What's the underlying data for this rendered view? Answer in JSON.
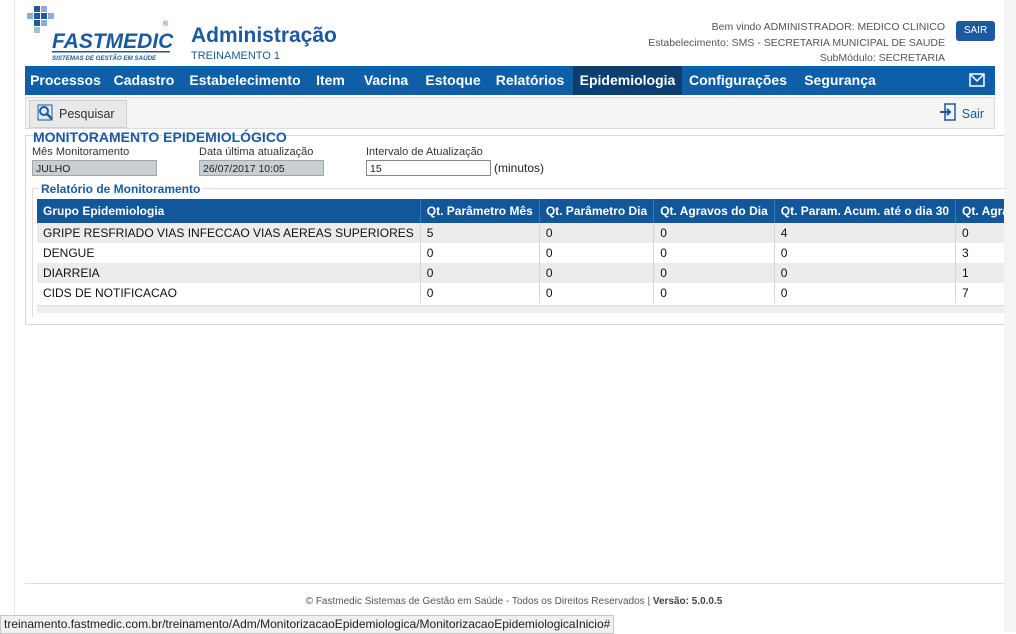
{
  "header": {
    "logo_text": "FASTMEDIC",
    "logo_tagline": "SISTEMAS DE GESTÃO EM SAÚDE",
    "title": "Administração",
    "subtitle": "TREINAMENTO 1",
    "welcome": "Bem vindo ADMINISTRADOR: MEDICO CLINICO",
    "establishment": "Estabelecimento: SMS - SECRETARIA MUNICIPAL DE SAUDE",
    "submodule": "SubMódulo: SECRETARIA",
    "logout_label": "SAIR"
  },
  "menu": {
    "items": [
      {
        "label": "Processos"
      },
      {
        "label": "Cadastro"
      },
      {
        "label": "Estabelecimento"
      },
      {
        "label": "Item"
      },
      {
        "label": "Vacina"
      },
      {
        "label": "Estoque"
      },
      {
        "label": "Relatórios"
      },
      {
        "label": "Epidemiologia"
      },
      {
        "label": "Configurações"
      },
      {
        "label": "Segurança"
      }
    ],
    "active": "Epidemiologia",
    "mail_icon": "envelope-icon"
  },
  "toolbar": {
    "search_label": "Pesquisar",
    "exit_label": "Sair"
  },
  "section": {
    "title": "MONITORAMENTO EPIDEMIOLÓGICO",
    "month_label": "Mês Monitoramento",
    "month_value": "JULHO",
    "last_update_label": "Data última atualização",
    "last_update_value": "26/07/2017 10:05",
    "interval_label": "Intervalo de Atualização",
    "interval_value": "15",
    "interval_unit": "(minutos)"
  },
  "report": {
    "title": "Relatório de Monitoramento",
    "columns": [
      "Grupo Epidemiologia",
      "Qt. Parâmetro Mês",
      "Qt. Parâmetro Dia",
      "Qt. Agravos do Dia",
      "Qt. Param. Acum. até o dia 30",
      "Qt. Agravos"
    ],
    "rows": [
      [
        "GRIPE RESFRIADO VIAS INFECCAO VIAS AEREAS SUPERIORES",
        "5",
        "0",
        "0",
        "4",
        "0"
      ],
      [
        "DENGUE",
        "0",
        "0",
        "0",
        "0",
        "3"
      ],
      [
        "DIARREIA",
        "0",
        "0",
        "0",
        "0",
        "1"
      ],
      [
        "CIDS DE NOTIFICACAO",
        "0",
        "0",
        "0",
        "0",
        "7"
      ]
    ]
  },
  "footer": {
    "text": "© Fastmedic Sistemas de Gestão em Saúde - Todos os Direitos Reservados |",
    "version": "Versão: 5.0.0.5"
  },
  "status_url": "treinamento.fastmedic.com.br/treinamento/Adm/MonitorizacaoEpidemiologica/MonitorizacaoEpidemiologicaInicio#",
  "colors": {
    "brand_blue": "#1c5aa0",
    "menu_bg": "#0e5fa8",
    "menu_active": "#0b3f73",
    "table_header": "#12579c"
  }
}
